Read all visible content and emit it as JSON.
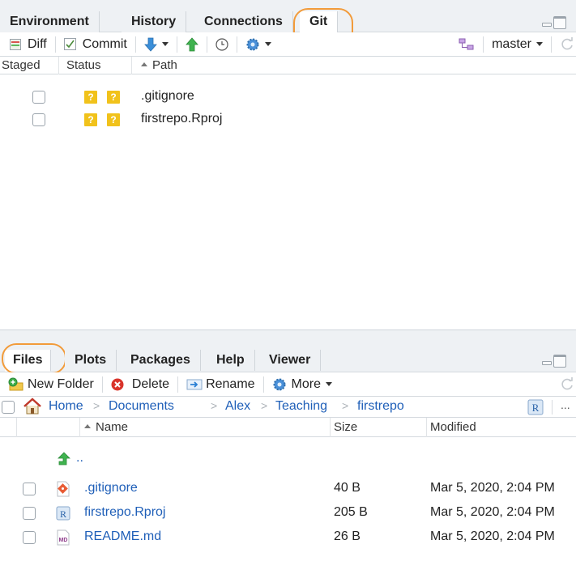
{
  "git_pane": {
    "tabs": [
      "Environment",
      "History",
      "Connections",
      "Git"
    ],
    "active_tab": "Git",
    "toolbar": {
      "diff": "Diff",
      "commit": "Commit",
      "branch": "master"
    },
    "columns": {
      "staged": "Staged",
      "status": "Status",
      "path": "Path"
    },
    "rows": [
      {
        "status": [
          "?",
          "?"
        ],
        "path": ".gitignore"
      },
      {
        "status": [
          "?",
          "?"
        ],
        "path": "firstrepo.Rproj"
      }
    ]
  },
  "files_pane": {
    "tabs": [
      "Files",
      "Plots",
      "Packages",
      "Help",
      "Viewer"
    ],
    "active_tab": "Files",
    "toolbar": {
      "new_folder": "New Folder",
      "delete": "Delete",
      "rename": "Rename",
      "more": "More"
    },
    "breadcrumb": [
      "Home",
      "Documents",
      "Alex",
      "Teaching",
      "firstrepo"
    ],
    "breadcrumb_more": "...",
    "columns": {
      "name": "Name",
      "size": "Size",
      "modified": "Modified"
    },
    "parent_dir": "..",
    "files": [
      {
        "name": ".gitignore",
        "size": "40 B",
        "modified": "Mar 5, 2020, 2:04 PM",
        "icon": "git-file-icon"
      },
      {
        "name": "firstrepo.Rproj",
        "size": "205 B",
        "modified": "Mar 5, 2020, 2:04 PM",
        "icon": "rproj-file-icon"
      },
      {
        "name": "README.md",
        "size": "26 B",
        "modified": "Mar 5, 2020, 2:04 PM",
        "icon": "markdown-file-icon"
      }
    ]
  },
  "colors": {
    "highlight_ring": "#f29b3a",
    "link": "#1f5fb8",
    "status_badge": "#f1c21b",
    "tab_bar": "#eef1f4"
  }
}
